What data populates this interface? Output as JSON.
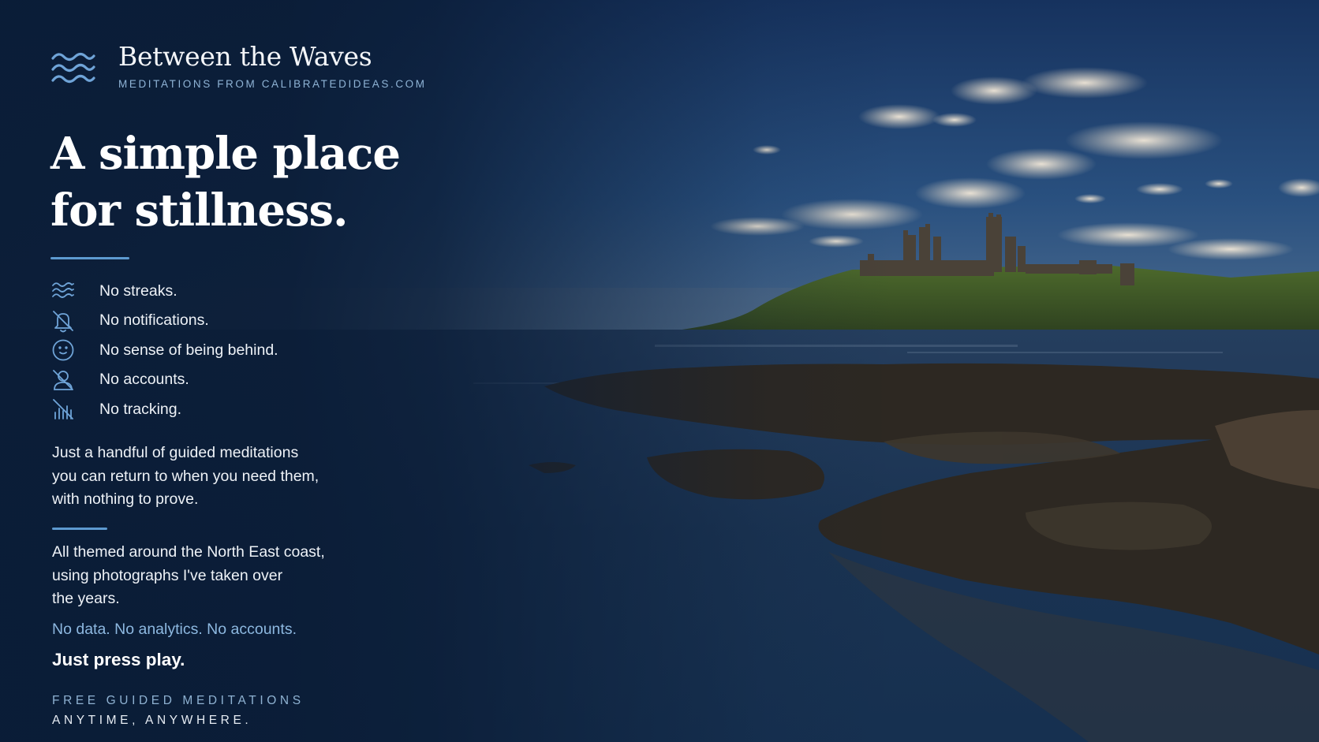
{
  "brand": {
    "icon": "waves-icon",
    "title": "Between the Waves",
    "subtitle": "MEDITATIONS FROM CALIBRATEDIDEAS.COM"
  },
  "headline": {
    "line1": "A simple place",
    "line2": "for stillness."
  },
  "features": [
    {
      "icon": "waves-icon",
      "label": "No streaks."
    },
    {
      "icon": "bell-off-icon",
      "label": "No notifications."
    },
    {
      "icon": "smile-icon",
      "label": "No sense of being behind."
    },
    {
      "icon": "user-off-icon",
      "label": "No accounts."
    },
    {
      "icon": "chart-off-icon",
      "label": "No tracking."
    }
  ],
  "intro": "Just a handful of guided meditations\nyou can return to when you need them,\nwith nothing to prove.",
  "theme_text": "All themed around the North East coast,\nusing photographs I've taken over\nthe years.",
  "tagline": "No data. No analytics. No accounts.",
  "cta": "Just press play.",
  "footer": {
    "line1": "FREE GUIDED MEDITATIONS",
    "line2": "ANYTIME, ANYWHERE."
  },
  "colors": {
    "background": "#0b1c36",
    "accent": "#5d9ad0",
    "accent_text": "#8db8e0"
  }
}
